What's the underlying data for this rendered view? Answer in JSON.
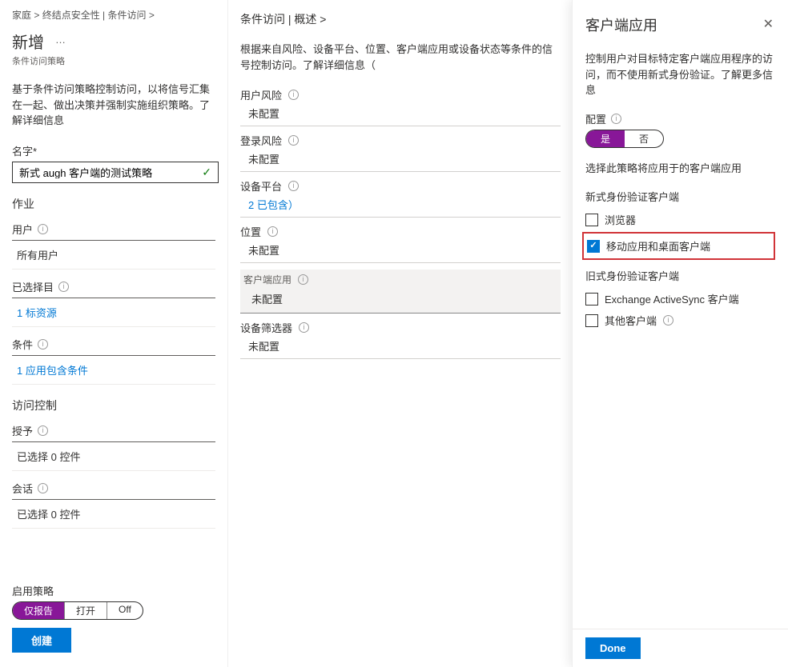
{
  "breadcrumb": {
    "home": "家庭",
    "gt": ">",
    "endpointSec": "终结点安全性",
    "condAccess": "条件访问"
  },
  "page": {
    "title": "新增",
    "subtitle": "条件访问策略"
  },
  "desc1": "基于条件访问策略控制访问，以将信号汇集在一起、做出决策并强制实施组织策略。了解详细信息",
  "nameLabel": "名字*",
  "nameValue": "新式 augh 客户端的测试策略",
  "assignments": "作业",
  "users": {
    "label": "用户",
    "value": "所有用户"
  },
  "targets": {
    "label": "已选择目",
    "value": "1 标资源"
  },
  "conditions": {
    "label": "条件",
    "value": "1 应用包含条件"
  },
  "accessControls": "访问控制",
  "grant": {
    "label": "授予",
    "value": "已选择 0 控件"
  },
  "session": {
    "label": "会话",
    "value": "已选择 0 控件"
  },
  "enablePolicy": "启用策略",
  "toggle3": {
    "report": "仅报告",
    "on": "打开",
    "off": "Off"
  },
  "createBtn": "创建",
  "col2": {
    "title": "条件访问 | 概述 >",
    "desc": "根据来自风险、设备平台、位置、客户端应用或设备状态等条件的信号控制访问。了解详细信息（",
    "userRisk": {
      "label": "用户风险",
      "value": "未配置"
    },
    "signinRisk": {
      "label": "登录风险",
      "value": "未配置"
    },
    "devicePlat": {
      "label": "设备平台",
      "value": "2 已包含）"
    },
    "locations": {
      "label": "位置",
      "value": "未配置"
    },
    "clientApps": {
      "label": "客户端应用",
      "value": "未配置"
    },
    "deviceFilter": {
      "label": "设备筛选器",
      "value": "未配置"
    }
  },
  "panel": {
    "title": "客户端应用",
    "desc": "控制用户对目标特定客户端应用程序的访问，而不使用新式身份验证。了解更多信息",
    "configure": "配置",
    "yes": "是",
    "no": "否",
    "selectDesc": "选择此策略将应用于的客户端应用",
    "modernAuth": "新式身份验证客户端",
    "browser": "浏览器",
    "mobileDesktop": "移动应用和桌面客户端",
    "legacyAuth": "旧式身份验证客户端",
    "exchangeAS": "Exchange ActiveSync 客户端",
    "otherClients": "其他客户端",
    "done": "Done"
  }
}
